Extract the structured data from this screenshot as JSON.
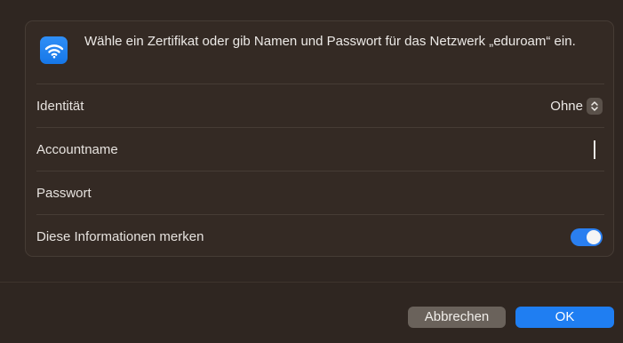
{
  "dialog": {
    "header_text": "Wähle ein Zertifikat oder gib Namen und Passwort für das Netzwerk „eduroam“ ein.",
    "icon": "wifi-icon",
    "accent_color": "#1f7ef2"
  },
  "form": {
    "identity": {
      "label": "Identität",
      "value": "Ohne"
    },
    "account": {
      "label": "Accountname",
      "value": ""
    },
    "password": {
      "label": "Passwort",
      "value": ""
    },
    "remember": {
      "label": "Diese Informationen merken",
      "enabled": true
    }
  },
  "buttons": {
    "cancel_label": "Abbrechen",
    "ok_label": "OK"
  }
}
